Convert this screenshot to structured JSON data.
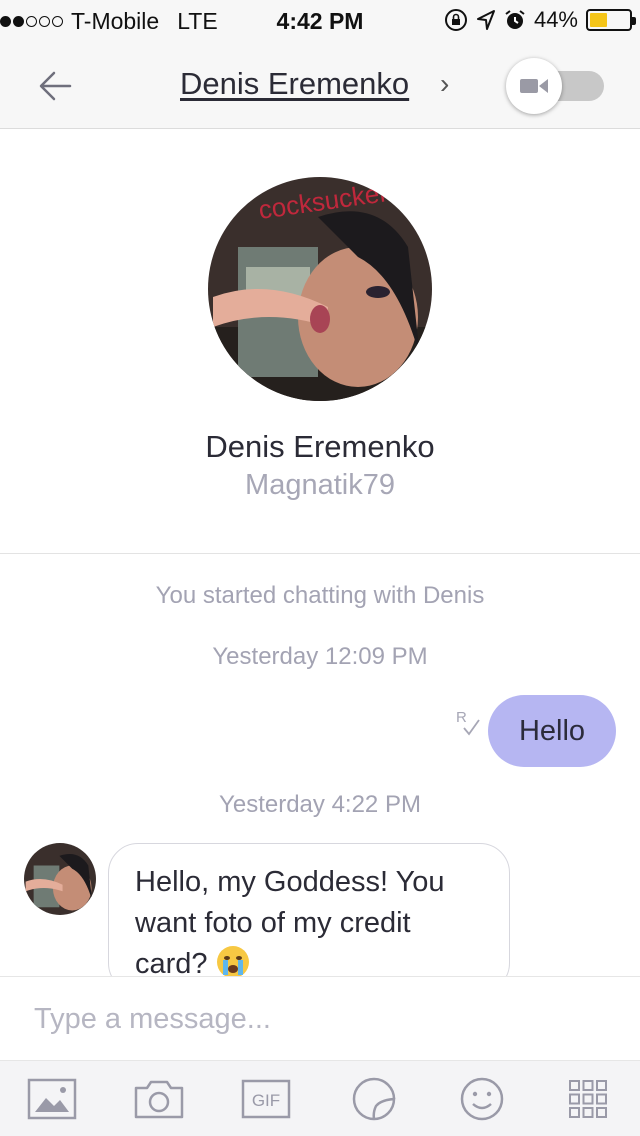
{
  "status_bar": {
    "carrier": "T-Mobile",
    "network": "LTE",
    "time": "4:42 PM",
    "battery_percent": "44%",
    "battery_level": 0.44,
    "signal_bars_filled": 2,
    "signal_bars_total": 5,
    "icons": [
      "orientation-lock-icon",
      "location-arrow-icon",
      "alarm-icon",
      "battery-icon"
    ],
    "battery_color": "#f5c518"
  },
  "header": {
    "title": "Denis Eremenko",
    "chevron": "›",
    "back_icon": "back-arrow-icon",
    "video_icon": "video-camera-icon"
  },
  "profile": {
    "name": "Denis Eremenko",
    "username": "Magnatik79",
    "avatar_overlay_text": "cocksucker"
  },
  "chat": {
    "system_message": "You started chatting with Denis",
    "timestamp_1": "Yesterday 12:09 PM",
    "outgoing_message": "Hello",
    "read_receipt": "R",
    "timestamp_2": "Yesterday 4:22 PM",
    "incoming_message_line1": "Hello, my Goddess! You",
    "incoming_message_line2": "want foto of my credit",
    "incoming_message_line3": "card?",
    "incoming_emoji": "crying-face-emoji"
  },
  "composer": {
    "placeholder": "Type a message..."
  },
  "toolbar": {
    "gif_label": "GIF",
    "items": [
      "gallery-icon",
      "camera-icon",
      "gif-icon",
      "sticker-icon",
      "emoji-icon",
      "more-grid-icon"
    ]
  },
  "colors": {
    "accent_bubble": "#b6b6f2",
    "secondary_text": "#a3a3b3",
    "bar_background": "#f7f7f7"
  }
}
